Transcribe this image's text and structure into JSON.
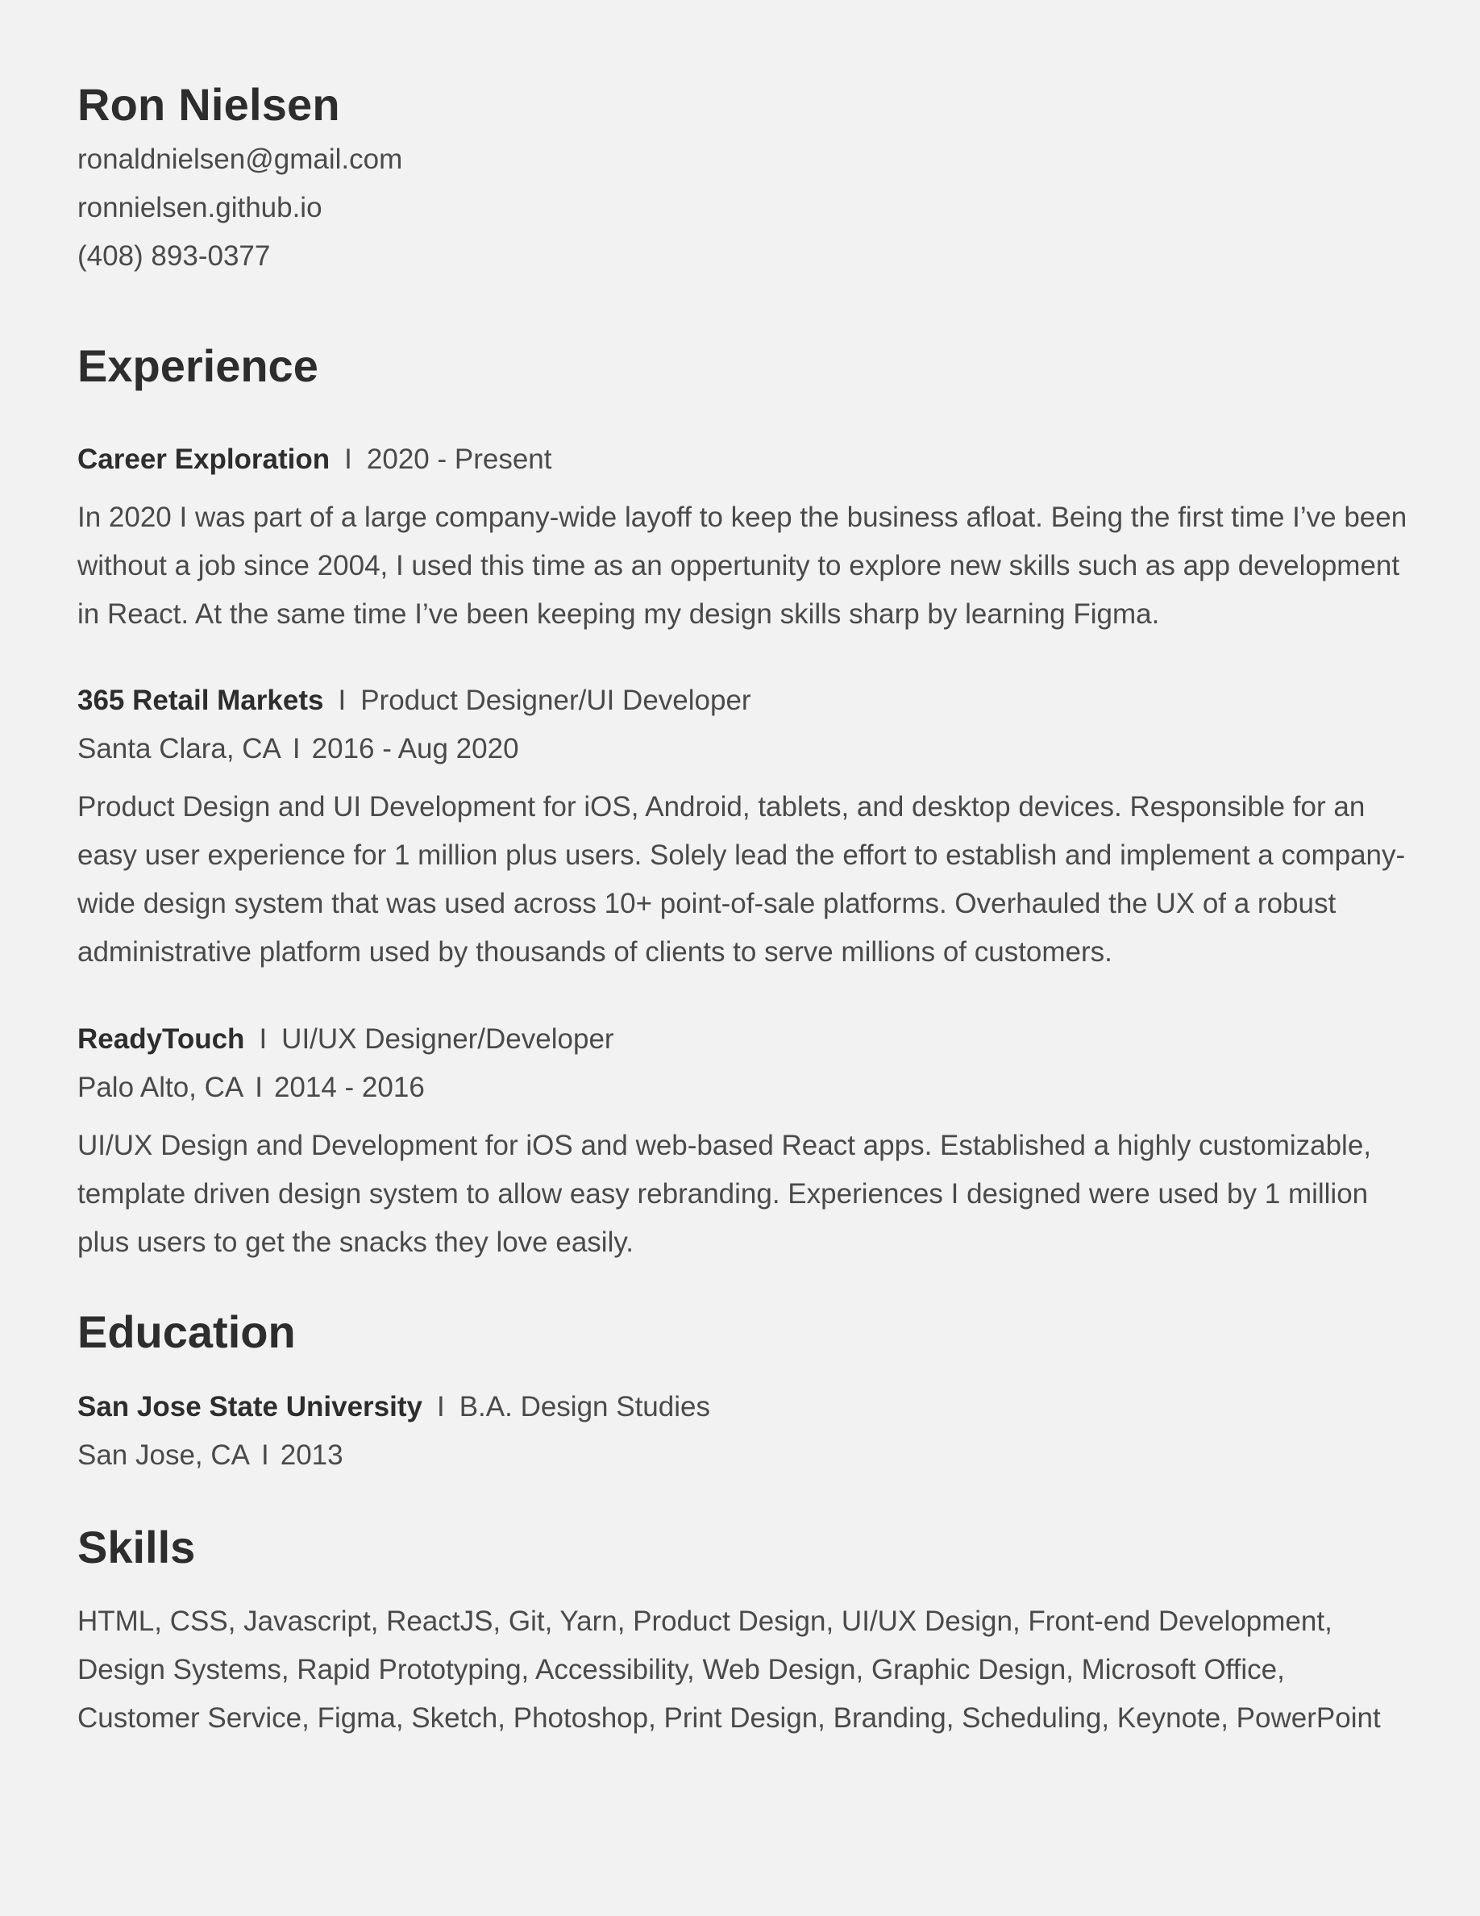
{
  "header": {
    "name": "Ron Nielsen",
    "email": "ronaldnielsen@gmail.com",
    "website": "ronnielsen.github.io",
    "phone": "(408) 893-0377"
  },
  "experience": {
    "title": "Experience",
    "entries": [
      {
        "org": "Career Exploration",
        "role": "2020 - Present",
        "location": "",
        "dates": "",
        "description": "In 2020 I was part of a large company-wide layoff to keep the business afloat. Being the first time I’ve been without a job since 2004, I used this time as an oppertunity to explore new skills such as app development in React. At the same time I’ve been keeping my design skills sharp by learning Figma."
      },
      {
        "org": "365 Retail Markets",
        "role": "Product Designer/UI Developer",
        "location": "Santa Clara, CA",
        "dates": "2016 - Aug 2020",
        "description": "Product Design and UI Development for iOS, Android, tablets, and desktop devices. Responsible for an easy user experience for 1 million plus users. Solely lead the effort to establish and implement a company-wide design system that was used across 10+ point-of-sale platforms. Overhauled the UX of a robust administrative platform used by thousands of clients to serve millions of customers."
      },
      {
        "org": "ReadyTouch",
        "role": "UI/UX Designer/Developer",
        "location": "Palo Alto, CA",
        "dates": "2014 - 2016",
        "description": "UI/UX Design and Development for iOS and web-based React apps. Established a highly customizable, template driven design system to allow easy rebranding. Experiences I designed were used by 1 million plus users to get the snacks they love easily."
      }
    ]
  },
  "education": {
    "title": "Education",
    "school": "San Jose State University",
    "degree": "B.A. Design Studies",
    "location": "San Jose, CA",
    "year": "2013"
  },
  "skills": {
    "title": "Skills",
    "text": "HTML, CSS, Javascript, ReactJS, Git, Yarn, Product Design, UI/UX Design, Front-end Development, Design Systems, Rapid Prototyping, Accessibility, Web Design, Graphic Design, Microsoft Office, Customer Service, Figma, Sketch, Photoshop, Print Design, Branding, Scheduling, Keynote, PowerPoint"
  },
  "separator": "I"
}
